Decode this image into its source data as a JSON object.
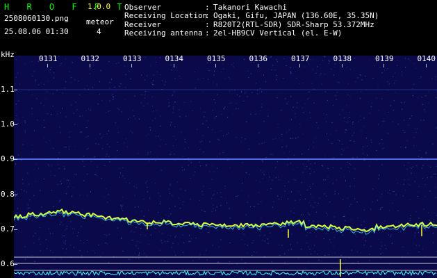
{
  "app": {
    "title": "H R O F F T",
    "version": "1.0.0",
    "filename": "2508060130.png",
    "datetime": "25.08.06 01:30",
    "meteor_label": "meteor",
    "meteor_count": "4"
  },
  "info": {
    "rows": [
      {
        "label": "Observer",
        "value": "Takanori Kawachi"
      },
      {
        "label": "Receiving Location",
        "value": "Ogaki, Gifu, JAPAN (136.60E, 35.35N)"
      },
      {
        "label": "Receiver",
        "value": "R820T2(RTL-SDR) SDR-Sharp 53.372MHz"
      },
      {
        "label": "Receiving antenna",
        "value": "2el-HB9CV Vertical (el. E-W)"
      }
    ],
    "separator": ":"
  },
  "axis": {
    "unit": "kHz",
    "time_ticks": [
      "0131",
      "0132",
      "0133",
      "0134",
      "0135",
      "0136",
      "0137",
      "0138",
      "0139",
      "0140"
    ],
    "freq_ticks": [
      "1.1",
      "1.0",
      "0.9",
      "0.8",
      "0.7",
      "0.6"
    ]
  },
  "colors": {
    "background": "#000000",
    "spectrogram_bg": "#0a0a4a",
    "label_green": "#00ff00",
    "label_yellow": "#ffff33",
    "signal_yellow": "#d8ff40",
    "signal_cyan": "#40e0ff",
    "carrier_blue": "#5a80ff"
  }
}
